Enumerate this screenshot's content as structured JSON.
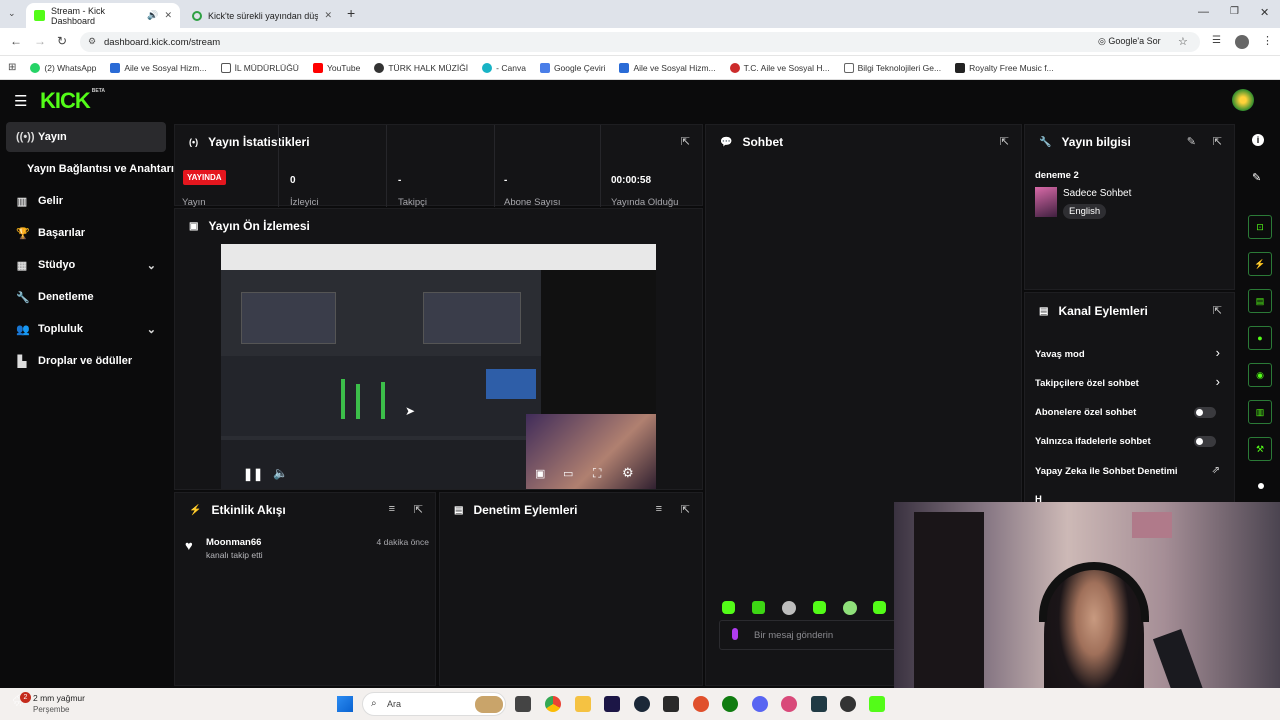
{
  "browser": {
    "tabs": [
      {
        "title": "Stream - Kick Dashboard",
        "active": true
      },
      {
        "title": "Kick'te sürekli yayından düşme",
        "active": false
      }
    ],
    "url": "dashboard.kick.com/stream",
    "google_ask": "Google'a Sor",
    "bookmarks": [
      {
        "label": "(2) WhatsApp",
        "color": "#25d366"
      },
      {
        "label": "Aile ve Sosyal Hizm...",
        "color": "#2a6bd6"
      },
      {
        "label": "İL MÜDÜRLÜĞÜ",
        "color": "#555555"
      },
      {
        "label": "YouTube",
        "color": "#ff0000"
      },
      {
        "label": "TÜRK HALK MÜZİĞİ",
        "color": "#333333"
      },
      {
        "label": "- Canva",
        "color": "#18b3c5"
      },
      {
        "label": "Google Çeviri",
        "color": "#4a7ee8"
      },
      {
        "label": "Aile ve Sosyal Hizm...",
        "color": "#2a6bd6"
      },
      {
        "label": "T.C. Aile ve Sosyal H...",
        "color": "#cc2b2b"
      },
      {
        "label": "Bilgi Teknolojileri Ge...",
        "color": "#666666"
      },
      {
        "label": "Royalty Free Music f...",
        "color": "#222222"
      }
    ]
  },
  "brand": {
    "logo": "KICK",
    "beta": "BETA",
    "accent": "#53fc18"
  },
  "sidebar": {
    "items": [
      {
        "label": "Yayın",
        "icon": "broadcast-icon",
        "active": true
      },
      {
        "label": "Yayın Bağlantısı ve Anahtarı",
        "icon": "",
        "active": false
      },
      {
        "label": "Gelir",
        "icon": "chart-icon",
        "active": false
      },
      {
        "label": "Başarılar",
        "icon": "trophy-icon",
        "active": false
      },
      {
        "label": "Stüdyo",
        "icon": "studio-icon",
        "active": false,
        "expandable": true
      },
      {
        "label": "Denetleme",
        "icon": "wrench-icon",
        "active": false
      },
      {
        "label": "Topluluk",
        "icon": "community-icon",
        "active": false,
        "expandable": true
      },
      {
        "label": "Droplar ve ödüller",
        "icon": "drops-icon",
        "active": false
      }
    ]
  },
  "stats": {
    "title": "Yayın İstatistikleri",
    "live_badge": "YAYINDA",
    "live_label": "Yayın",
    "cells": [
      {
        "value": "0",
        "label": "İzleyici"
      },
      {
        "value": "-",
        "label": "Takipçi"
      },
      {
        "value": "-",
        "label": "Abone Sayısı"
      },
      {
        "value": "00:00:58",
        "label": "Yayında Olduğu"
      }
    ]
  },
  "preview": {
    "title": "Yayın Ön İzlemesi"
  },
  "activity": {
    "title": "Etkinlik Akışı",
    "items": [
      {
        "user": "Moonman66",
        "text": "kanalı takip etti",
        "time": "4 dakika önce"
      }
    ]
  },
  "moderation": {
    "title": "Denetim Eylemleri"
  },
  "chat": {
    "title": "Sohbet",
    "placeholder": "Bir mesaj gönderin"
  },
  "stream_info": {
    "title": "Yayın bilgisi",
    "stream_title": "deneme 2",
    "category": "Sadece Sohbet",
    "language": "English"
  },
  "channel_actions": {
    "title": "Kanal Eylemleri",
    "items": [
      {
        "label": "Yavaş mod",
        "kind": "chevron"
      },
      {
        "label": "Takipçilere özel sohbet",
        "kind": "chevron"
      },
      {
        "label": "Abonelere özel sohbet",
        "kind": "toggle",
        "on": false
      },
      {
        "label": "Yalnızca ifadelerle sohbet",
        "kind": "toggle",
        "on": false
      },
      {
        "label": "Yapay Zeka ile Sohbet Denetimi",
        "kind": "external"
      }
    ],
    "partial_label": "H"
  },
  "taskbar": {
    "weather": "2 mm yağmur",
    "day": "Perşembe",
    "search": "Ara",
    "notification_count": "2"
  }
}
